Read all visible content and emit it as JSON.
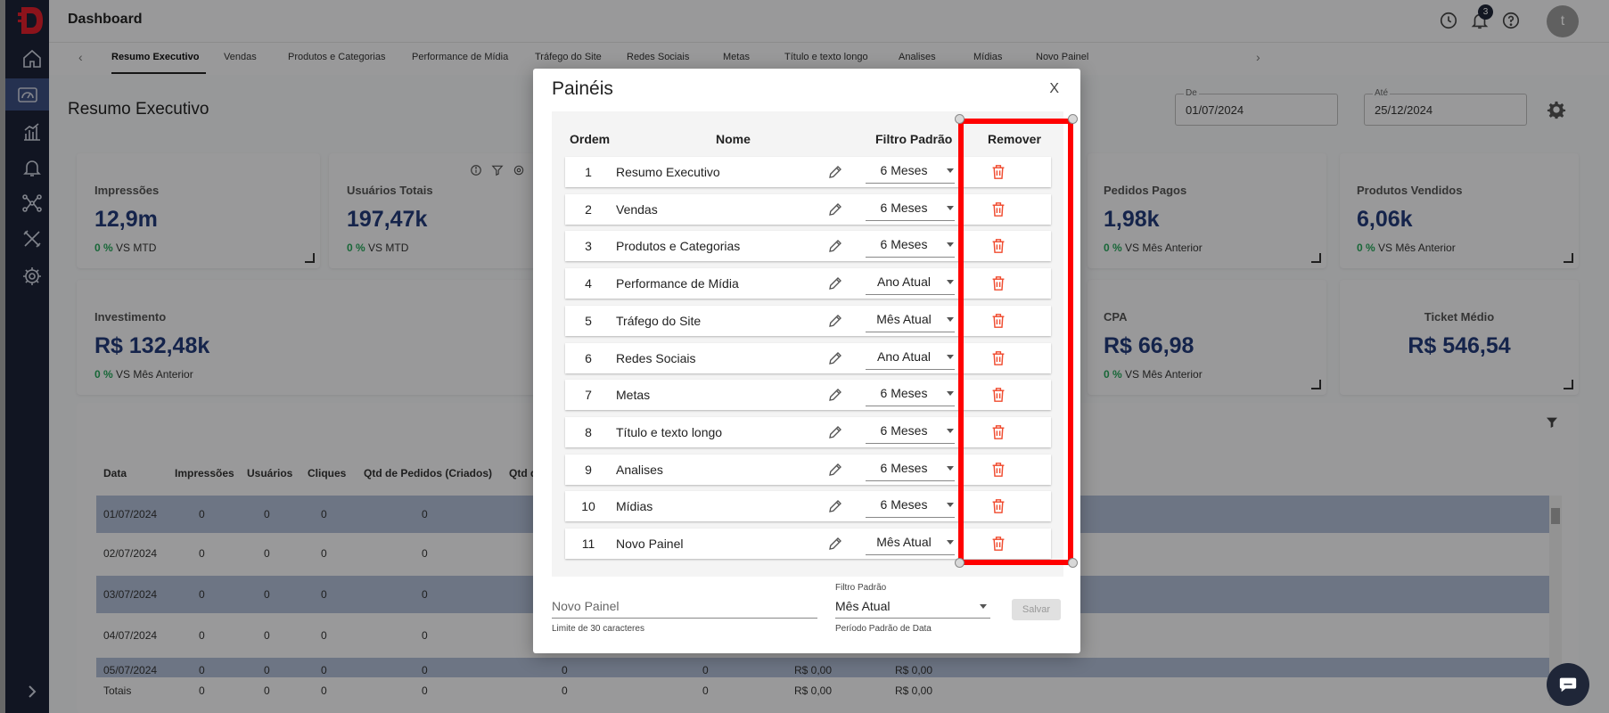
{
  "header": {
    "title": "Dashboard",
    "notification_count": "3",
    "avatar_initial": "t"
  },
  "tabs": [
    "Resumo Executivo",
    "Vendas",
    "Produtos e Categorias",
    "Performance de Mídia",
    "Tráfego do Site",
    "Redes Sociais",
    "Metas",
    "Título e texto longo",
    "Analises",
    "Mídias",
    "Novo Painel"
  ],
  "page": {
    "title": "Resumo Executivo",
    "date_from_label": "De",
    "date_from": "01/07/2024",
    "date_to_label": "Até",
    "date_to": "25/12/2024"
  },
  "cards": {
    "impressoes": {
      "label": "Impressões",
      "value": "12,9m",
      "pct": "0 %",
      "cmp": " VS MTD"
    },
    "usuarios": {
      "label": "Usuários Totais",
      "value": "197,47k",
      "pct": "0 %",
      "cmp": " VS MTD"
    },
    "pedidos": {
      "label": "Pedidos Pagos",
      "value": "1,98k",
      "pct": "0 %",
      "cmp": " VS Mês Anterior"
    },
    "produtos": {
      "label": "Produtos Vendidos",
      "value": "6,06k",
      "pct": "0 %",
      "cmp": " VS Mês Anterior"
    },
    "investimento": {
      "label": "Investimento",
      "value": "R$ 132,48k",
      "pct": "0 %",
      "cmp": " VS Mês Anterior"
    },
    "cpa": {
      "label": "CPA",
      "value": "R$ 66,98",
      "pct": "0 %",
      "cmp": " VS Mês Anterior"
    },
    "ticket": {
      "label": "Ticket Médio",
      "value": "R$ 546,54"
    }
  },
  "table": {
    "headers": [
      "Data",
      "Impressões",
      "Usuários",
      "Cliques",
      "Qtd de Pedidos (Criados)",
      "Qtd d"
    ],
    "rows": [
      [
        "01/07/2024",
        "0",
        "0",
        "0",
        "0"
      ],
      [
        "02/07/2024",
        "0",
        "0",
        "0",
        "0"
      ],
      [
        "03/07/2024",
        "0",
        "0",
        "0",
        "0"
      ],
      [
        "04/07/2024",
        "0",
        "0",
        "0",
        "0"
      ],
      [
        "05/07/2024",
        "0",
        "0",
        "0",
        "0",
        "0",
        "0",
        "R$ 0,00",
        "R$ 0,00"
      ]
    ],
    "totals": [
      "Totais",
      "0",
      "0",
      "0",
      "0",
      "0",
      "0",
      "R$ 0,00",
      "R$ 0,00"
    ]
  },
  "modal": {
    "title": "Painéis",
    "close": "X",
    "headers": {
      "ordem": "Ordem",
      "nome": "Nome",
      "filtro": "Filtro Padrão",
      "remover": "Remover"
    },
    "panels": [
      {
        "ordem": "1",
        "nome": "Resumo Executivo",
        "filtro": "6 Meses"
      },
      {
        "ordem": "2",
        "nome": "Vendas",
        "filtro": "6 Meses"
      },
      {
        "ordem": "3",
        "nome": "Produtos e Categorias",
        "filtro": "6 Meses"
      },
      {
        "ordem": "4",
        "nome": "Performance de Mídia",
        "filtro": "Ano Atual"
      },
      {
        "ordem": "5",
        "nome": "Tráfego do Site",
        "filtro": "Mês Atual"
      },
      {
        "ordem": "6",
        "nome": "Redes Sociais",
        "filtro": "Ano Atual"
      },
      {
        "ordem": "7",
        "nome": "Metas",
        "filtro": "6 Meses"
      },
      {
        "ordem": "8",
        "nome": "Título e texto longo",
        "filtro": "6 Meses"
      },
      {
        "ordem": "9",
        "nome": "Analises",
        "filtro": "6 Meses"
      },
      {
        "ordem": "10",
        "nome": "Mídias",
        "filtro": "6 Meses"
      },
      {
        "ordem": "11",
        "nome": "Novo Painel",
        "filtro": "Mês Atual"
      }
    ],
    "new_panel": {
      "value": "",
      "placeholder": "Novo Painel",
      "helper": "Limite de 30 caracteres",
      "filter_label": "Filtro Padrão",
      "filter_value": "Mês Atual",
      "filter_helper": "Período Padrão de Data",
      "save_label": "Salvar"
    }
  },
  "colors": {
    "sidebar": "#1c2238",
    "accent_blue": "#233a7a",
    "positive": "#27a65b",
    "delete": "#f04b2f",
    "highlight": "#ff0000"
  },
  "icons": [
    "home-icon",
    "dashboard-gauge-icon",
    "bar-chart-icon",
    "bell-icon",
    "network-icon",
    "tools-icon",
    "gear-icon",
    "history-icon",
    "help-icon",
    "pencil-icon",
    "trash-icon",
    "chat-icon",
    "filter-icon"
  ]
}
